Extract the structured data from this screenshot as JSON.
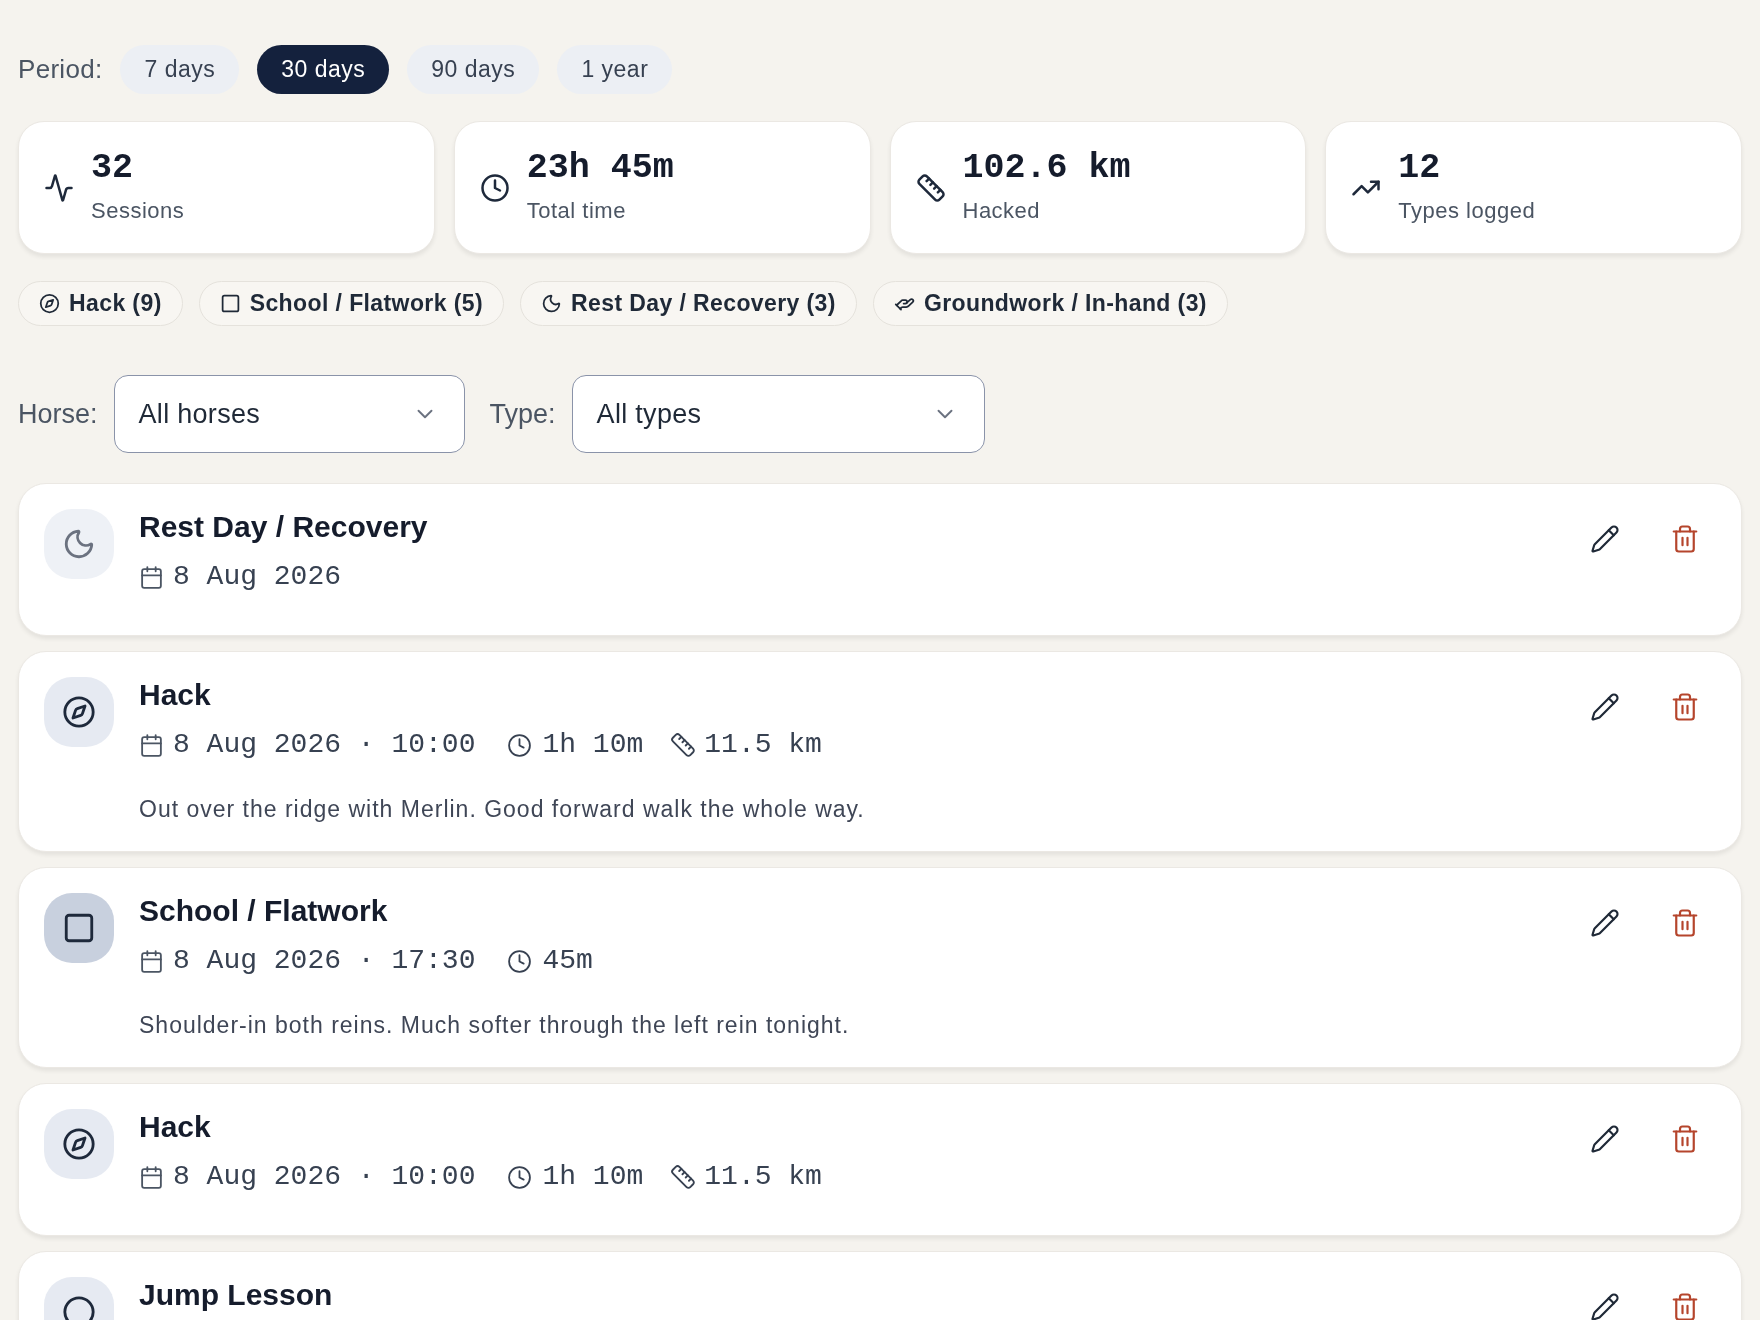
{
  "period": {
    "label": "Period:",
    "options": [
      {
        "label": "7 days",
        "selected": false
      },
      {
        "label": "30 days",
        "selected": true
      },
      {
        "label": "90 days",
        "selected": false
      },
      {
        "label": "1 year",
        "selected": false
      }
    ]
  },
  "stats": [
    {
      "kind": "sessions",
      "value": "32",
      "label": "Sessions"
    },
    {
      "kind": "time",
      "value": "23h 45m",
      "label": "Total time"
    },
    {
      "kind": "distance",
      "value": "102.6 km",
      "label": "Hacked"
    },
    {
      "kind": "types",
      "value": "12",
      "label": "Types logged"
    }
  ],
  "type_chips": [
    {
      "kind": "hack",
      "label": "Hack (9)"
    },
    {
      "kind": "school",
      "label": "School / Flatwork (5)"
    },
    {
      "kind": "rest",
      "label": "Rest Day / Recovery (3)"
    },
    {
      "kind": "groundwork",
      "label": "Groundwork / In-hand (3)"
    }
  ],
  "filters": [
    {
      "label": "Horse:",
      "value": "All horses"
    },
    {
      "label": "Type:",
      "value": "All types"
    }
  ],
  "sessions": [
    {
      "kind": "rest",
      "color": "#eef1f6",
      "title": "Rest Day / Recovery",
      "when": "8 Aug 2026"
    },
    {
      "kind": "hack",
      "color": "#e6eaf2",
      "title": "Hack",
      "when": "8 Aug 2026 · 10:00",
      "duration": "1h 10m",
      "distance": "11.5 km",
      "note": "Out over the ridge with Merlin. Good forward walk the whole way."
    },
    {
      "kind": "school",
      "color": "#c8d0de",
      "title": "School / Flatwork",
      "when": "8 Aug 2026 · 17:30",
      "duration": "45m",
      "note": "Shoulder-in both reins. Much softer through the left rein tonight."
    },
    {
      "kind": "hack",
      "color": "#e6eaf2",
      "title": "Hack",
      "when": "8 Aug 2026 · 10:00",
      "duration": "1h 10m",
      "distance": "11.5 km"
    },
    {
      "kind": "jump",
      "color": "#e6eaf2",
      "title": "Jump Lesson"
    }
  ]
}
